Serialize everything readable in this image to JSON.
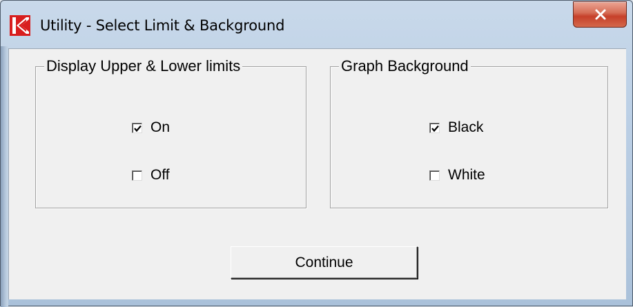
{
  "window": {
    "title": "Utility - Select Limit & Background",
    "close_symbol": "x",
    "icon": "app-k-logo-icon"
  },
  "limits_group": {
    "legend": "Display Upper & Lower limits",
    "options": [
      {
        "label": "On",
        "checked": true
      },
      {
        "label": "Off",
        "checked": false
      }
    ]
  },
  "background_group": {
    "legend": "Graph Background",
    "options": [
      {
        "label": "Black",
        "checked": true
      },
      {
        "label": "White",
        "checked": false
      }
    ]
  },
  "continue_button": {
    "label": "Continue"
  },
  "colors": {
    "dialog_bg": "#f0f0f0",
    "close_red": "#c6402a",
    "logo_red": "#d81e1e"
  }
}
